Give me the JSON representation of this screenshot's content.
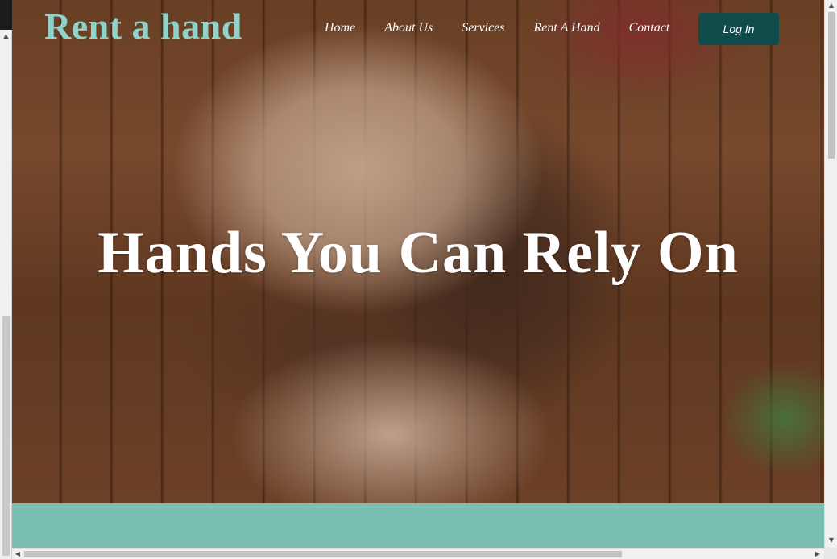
{
  "brand": {
    "name": "Rent a hand"
  },
  "nav": {
    "items": [
      {
        "label": "Home"
      },
      {
        "label": "About Us"
      },
      {
        "label": "Services"
      },
      {
        "label": "Rent A Hand"
      },
      {
        "label": "Contact"
      }
    ],
    "login_label": "Log In"
  },
  "hero": {
    "title": "Hands You Can Rely On",
    "image": "hands-stacked-on-wooden-table"
  },
  "colors": {
    "brand": "#8fd3ca",
    "login_button": "#0f4b4b",
    "accent_band": "#7bbfb3",
    "hero_text": "#ffffff"
  },
  "icons": {
    "scroll_up": "▲",
    "scroll_down": "▼",
    "scroll_left": "◀",
    "scroll_right": "▶"
  }
}
